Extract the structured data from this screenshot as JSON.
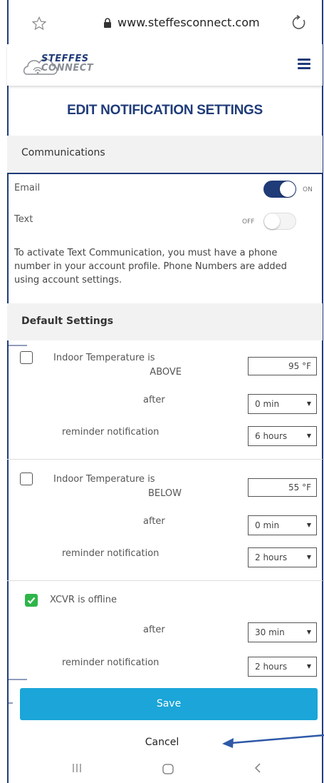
{
  "browser": {
    "url": "www.steffesconnect.com"
  },
  "header": {
    "logo_line1": "STEFFES",
    "logo_line2": "CONNECT"
  },
  "page_title": "EDIT NOTIFICATION SETTINGS",
  "communications": {
    "heading": "Communications",
    "email": {
      "label": "Email",
      "state": "ON"
    },
    "text": {
      "label": "Text",
      "state": "OFF"
    },
    "info": "To activate Text Communication, you must have a phone number in your account profile. Phone Numbers are added using account settings."
  },
  "defaults": {
    "heading": "Default Settings",
    "after_label": "after",
    "reminder_label": "reminder notification",
    "alerts": [
      {
        "title_line1": "Indoor Temperature is",
        "title_line2": "ABOVE",
        "checked": false,
        "temp": "95 °F",
        "after": "0 min",
        "reminder": "6 hours"
      },
      {
        "title_line1": "Indoor Temperature is",
        "title_line2": "BELOW",
        "checked": false,
        "temp": "55 °F",
        "after": "0 min",
        "reminder": "2 hours"
      },
      {
        "title_line1": "XCVR is offline",
        "checked": true,
        "after": "30 min",
        "reminder": "2 hours"
      }
    ]
  },
  "buttons": {
    "save": "Save",
    "cancel": "Cancel"
  },
  "colors": {
    "brand": "#1f3b78",
    "save": "#1ba5d8",
    "check": "#2eb54a"
  }
}
